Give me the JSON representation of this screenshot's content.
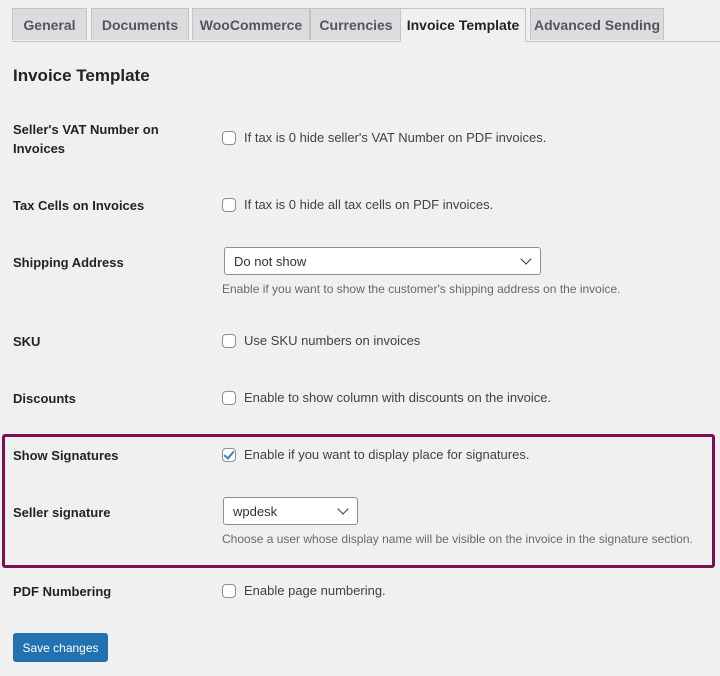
{
  "tabs": [
    {
      "label": "General",
      "active": false
    },
    {
      "label": "Documents",
      "active": false
    },
    {
      "label": "WooCommerce",
      "active": false
    },
    {
      "label": "Currencies",
      "active": false
    },
    {
      "label": "Invoice Template",
      "active": true
    },
    {
      "label": "Advanced Sending",
      "active": false
    }
  ],
  "page_title": "Invoice Template",
  "fields": {
    "seller_vat": {
      "label": "Seller's VAT Number on Invoices",
      "checkbox_label": "If tax is 0 hide seller's VAT Number on PDF invoices.",
      "checked": false
    },
    "tax_cells": {
      "label": "Tax Cells on Invoices",
      "checkbox_label": "If tax is 0 hide all tax cells on PDF invoices.",
      "checked": false
    },
    "shipping_address": {
      "label": "Shipping Address",
      "selected": "Do not show",
      "description": "Enable if you want to show the customer's shipping address on the invoice."
    },
    "sku": {
      "label": "SKU",
      "checkbox_label": "Use SKU numbers on invoices",
      "checked": false
    },
    "discounts": {
      "label": "Discounts",
      "checkbox_label": "Enable to show column with discounts on the invoice.",
      "checked": false
    },
    "show_signatures": {
      "label": "Show Signatures",
      "checkbox_label": "Enable if you want to display place for signatures.",
      "checked": true
    },
    "seller_signature": {
      "label": "Seller signature",
      "selected": "wpdesk",
      "description": "Choose a user whose display name will be visible on the invoice in the signature section."
    },
    "pdf_numbering": {
      "label": "PDF Numbering",
      "checkbox_label": "Enable page numbering.",
      "checked": false
    }
  },
  "save_button": "Save changes",
  "colors": {
    "highlight": "#7a1052",
    "primary": "#2271b1"
  }
}
